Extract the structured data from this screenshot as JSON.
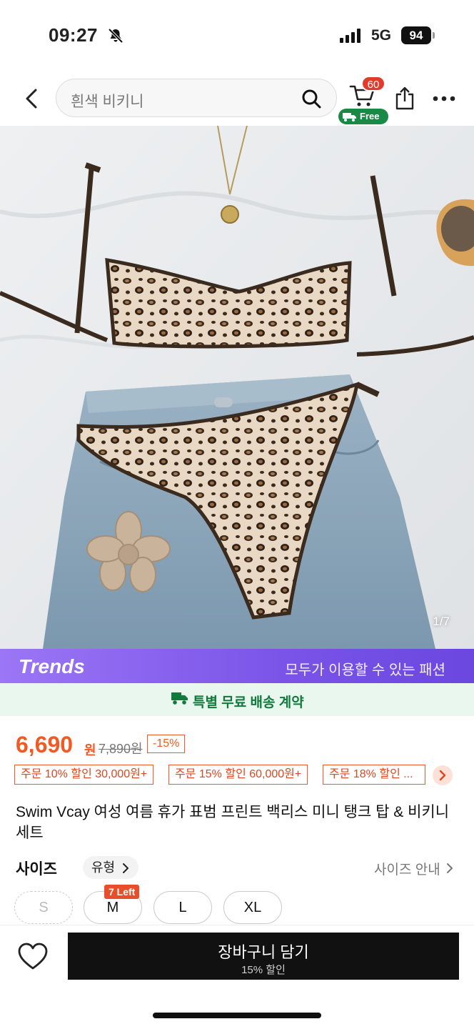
{
  "status_bar": {
    "time": "09:27",
    "network": "5G",
    "battery": "94"
  },
  "nav": {
    "search_placeholder": "흰색 비키니",
    "cart_count": "60",
    "free_label": "Free"
  },
  "gallery": {
    "counter": "1/7"
  },
  "trends": {
    "title": "Trends",
    "subtitle": "모두가 이용할 수 있는 패션"
  },
  "shipping": {
    "text": "특별 무료 배송 계약"
  },
  "price": {
    "current": "6,690",
    "unit": "원",
    "original": "7,890원",
    "discount": "-15%"
  },
  "coupons": [
    "주문 10% 할인 30,000원+",
    "주문 15% 할인 60,000원+",
    "주문 18% 할인 ..."
  ],
  "product": {
    "title": "Swim Vcay 여성 여름 휴가 표범 프린트 백리스 미니 탱크 탑 & 비키니 세트"
  },
  "size": {
    "label": "사이즈",
    "type_chip": "유형",
    "guide": "사이즈 안내",
    "options": [
      "S",
      "M",
      "L",
      "XL"
    ],
    "m_badge": "7 Left"
  },
  "cta": {
    "label": "장바구니 담기",
    "sub": "15% 할인"
  },
  "colors": {
    "accent": "#f15a24",
    "trends": "#7a54e8",
    "shipping": "#0f7a3c",
    "cta": "#111111"
  }
}
